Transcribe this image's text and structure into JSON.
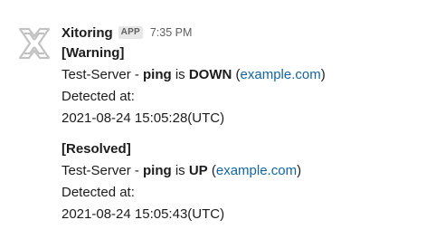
{
  "message": {
    "sender": "Xitoring",
    "badge": "APP",
    "time": "7:35 PM",
    "alerts": [
      {
        "title": "[Warning]",
        "server": "Test-Server - ",
        "check": "ping",
        "is_text": " is ",
        "status": "DOWN",
        "link_open": " (",
        "link": "example.com",
        "link_close": ")",
        "detected_label": "Detected at:",
        "timestamp": "2021-08-24 15:05:28(UTC)"
      },
      {
        "title": "[Resolved]",
        "server": "Test-Server - ",
        "check": "ping",
        "is_text": " is ",
        "status": "UP",
        "link_open": " (",
        "link": "example.com",
        "link_close": ")",
        "detected_label": "Detected at:",
        "timestamp": "2021-08-24 15:05:43(UTC)"
      }
    ]
  },
  "colors": {
    "text": "#1d1c1d",
    "muted": "#616061",
    "link": "#1264a3",
    "avatar": "#c7c7c7"
  },
  "icons": {
    "avatar": "xitoring-logo-icon"
  }
}
